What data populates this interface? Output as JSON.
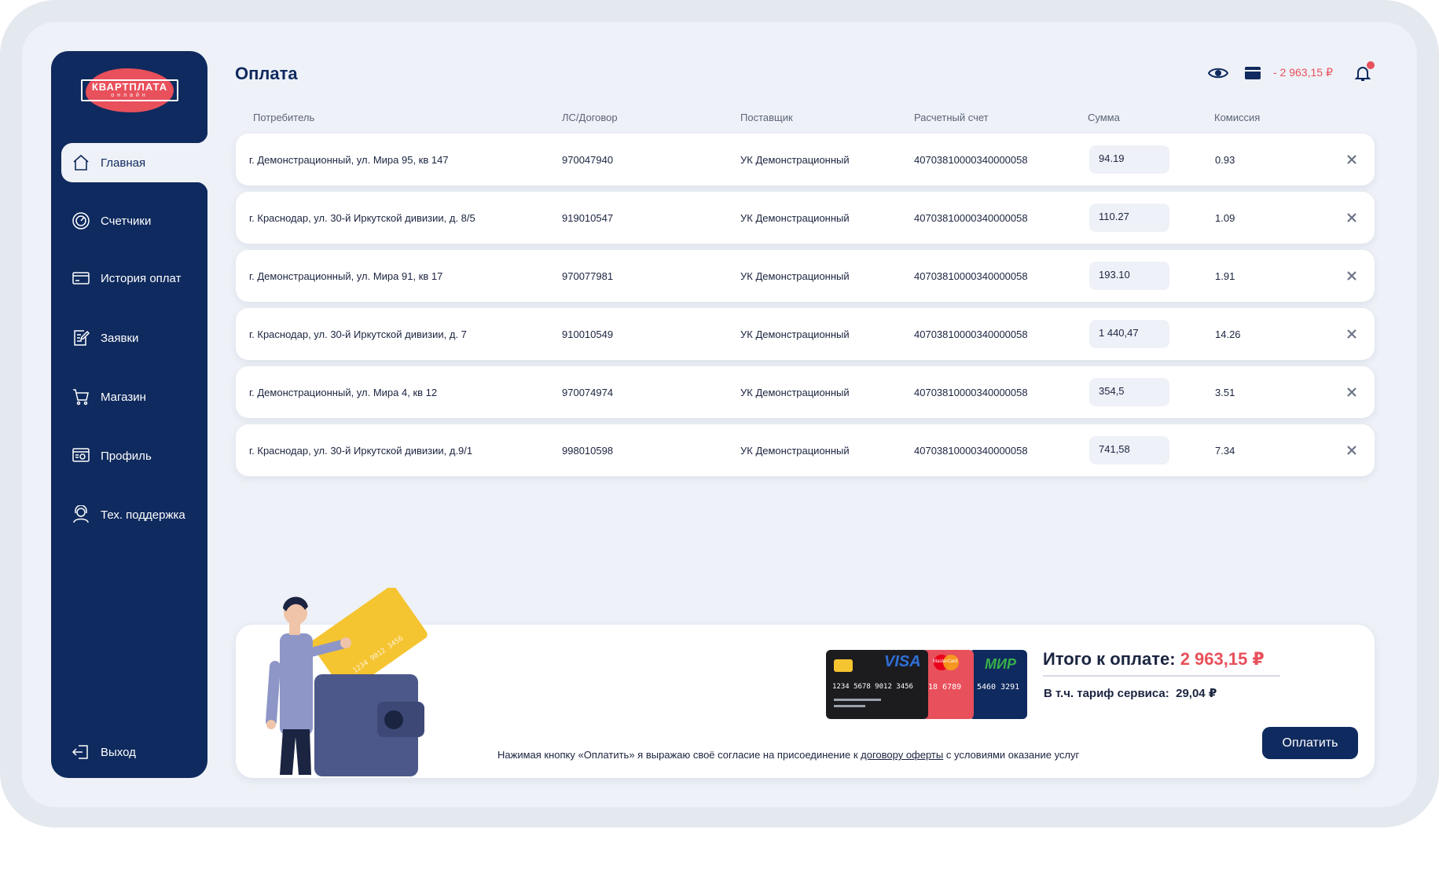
{
  "app": {
    "logo_name": "КВАРТПЛАТА",
    "logo_sub": "онлайн"
  },
  "colors": {
    "primary": "#0f2a5e",
    "accent": "#e8505b",
    "background": "#eef1f7"
  },
  "sidebar": {
    "items": [
      {
        "label": "Главная",
        "icon": "home-icon",
        "active": true
      },
      {
        "label": "Счетчики",
        "icon": "meter-icon"
      },
      {
        "label": "История оплат",
        "icon": "card-icon"
      },
      {
        "label": "Заявки",
        "icon": "request-icon"
      },
      {
        "label": "Магазин",
        "icon": "cart-icon"
      },
      {
        "label": "Профиль",
        "icon": "profile-icon"
      },
      {
        "label": "Тех. поддержка",
        "icon": "support-icon"
      }
    ],
    "logout": {
      "label": "Выход",
      "icon": "logout-icon"
    }
  },
  "header": {
    "title": "Оплата",
    "balance": "- 2 963,15 ₽",
    "icons": [
      "eye-icon",
      "wallet-icon",
      "bell-icon"
    ]
  },
  "table": {
    "columns": [
      "Потребитель",
      "ЛС/Договор",
      "Поставщик",
      "Расчетный счет",
      "Сумма",
      "Комиссия"
    ],
    "rows": [
      {
        "consumer": "г. Демонстрационный, ул. Мира 95, кв 147",
        "account": "970047940",
        "supplier": "УК Демонстрационный",
        "bank_account": "40703810000340000058",
        "sum": "94.19",
        "fee": "0.93"
      },
      {
        "consumer": "г. Краснодар, ул. 30-й Иркутской дивизии, д. 8/5",
        "account": "919010547",
        "supplier": "УК Демонстрационный",
        "bank_account": "40703810000340000058",
        "sum": "110.27",
        "fee": "1.09"
      },
      {
        "consumer": "г. Демонстрационный, ул. Мира 91, кв 17",
        "account": "970077981",
        "supplier": "УК Демонстрационный",
        "bank_account": "40703810000340000058",
        "sum": "193.10",
        "fee": "1.91"
      },
      {
        "consumer": "г. Краснодар, ул. 30-й Иркутской дивизии, д. 7",
        "account": "910010549",
        "supplier": "УК Демонстрационный",
        "bank_account": "40703810000340000058",
        "sum": "1 440,47",
        "fee": "14.26"
      },
      {
        "consumer": "г. Демонстрационный, ул. Мира 4, кв 12",
        "account": "970074974",
        "supplier": "УК Демонстрационный",
        "bank_account": "40703810000340000058",
        "sum": "354,5",
        "fee": "3.51"
      },
      {
        "consumer": "г. Краснодар, ул. 30-й Иркутской дивизии, д.9/1",
        "account": "998010598",
        "supplier": "УК Демонстрационный",
        "bank_account": "40703810000340000058",
        "sum": "741,58",
        "fee": "7.34"
      }
    ]
  },
  "payment": {
    "total_label": "Итого к оплате:",
    "total_amount": "2 963,15 ₽",
    "tariff_label": "В т.ч. тариф сервиса:",
    "tariff_amount": "29,04 ₽",
    "consent_before": "Нажимая кнопку «Оплатить» я выражаю своё согласие на присоединение к",
    "consent_link": "договору оферты",
    "consent_after": "с условиями оказание услуг",
    "pay_button": "Оплатить",
    "cards": {
      "visa_brand": "VISA",
      "visa_number": "1234  5678  9012  3456",
      "mastercard_brand": "MasterCard",
      "mastercard_number": "018  6789",
      "mir_brand": "МИР",
      "mir_number": "5460  3291",
      "gold_card_number": "1234  9012  3456"
    }
  }
}
